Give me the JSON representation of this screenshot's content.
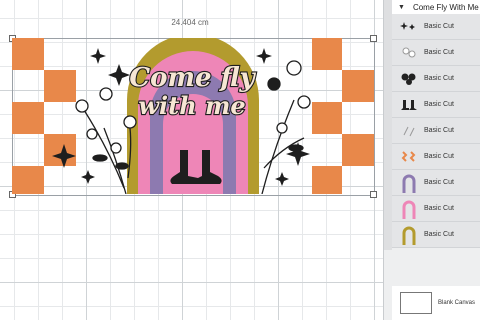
{
  "canvas": {
    "dimension_label": "24.404 cm",
    "design": {
      "headline_line1": "Come fly",
      "headline_line2": "with me",
      "colors": {
        "orange": "#e8884a",
        "olive": "#b39b2e",
        "purple": "#8d7ab0",
        "pink": "#ee86b7",
        "black": "#1e1e1e"
      }
    }
  },
  "layers_panel": {
    "group_title": "Come Fly With Me",
    "items": [
      {
        "label": "Basic Cut",
        "icon": "sparkles-icon"
      },
      {
        "label": "Basic Cut",
        "icon": "flowers-white-icon"
      },
      {
        "label": "Basic Cut",
        "icon": "flowers-black-icon"
      },
      {
        "label": "Basic Cut",
        "icon": "witch-boots-icon"
      },
      {
        "label": "Basic Cut",
        "icon": "lines-icon"
      },
      {
        "label": "Basic Cut",
        "icon": "orange-zigzag-icon"
      },
      {
        "label": "Basic Cut",
        "icon": "purple-arch-icon"
      },
      {
        "label": "Basic Cut",
        "icon": "pink-arch-icon"
      },
      {
        "label": "Basic Cut",
        "icon": "olive-arch-icon"
      }
    ],
    "blank_canvas_label": "Blank Canvas"
  }
}
